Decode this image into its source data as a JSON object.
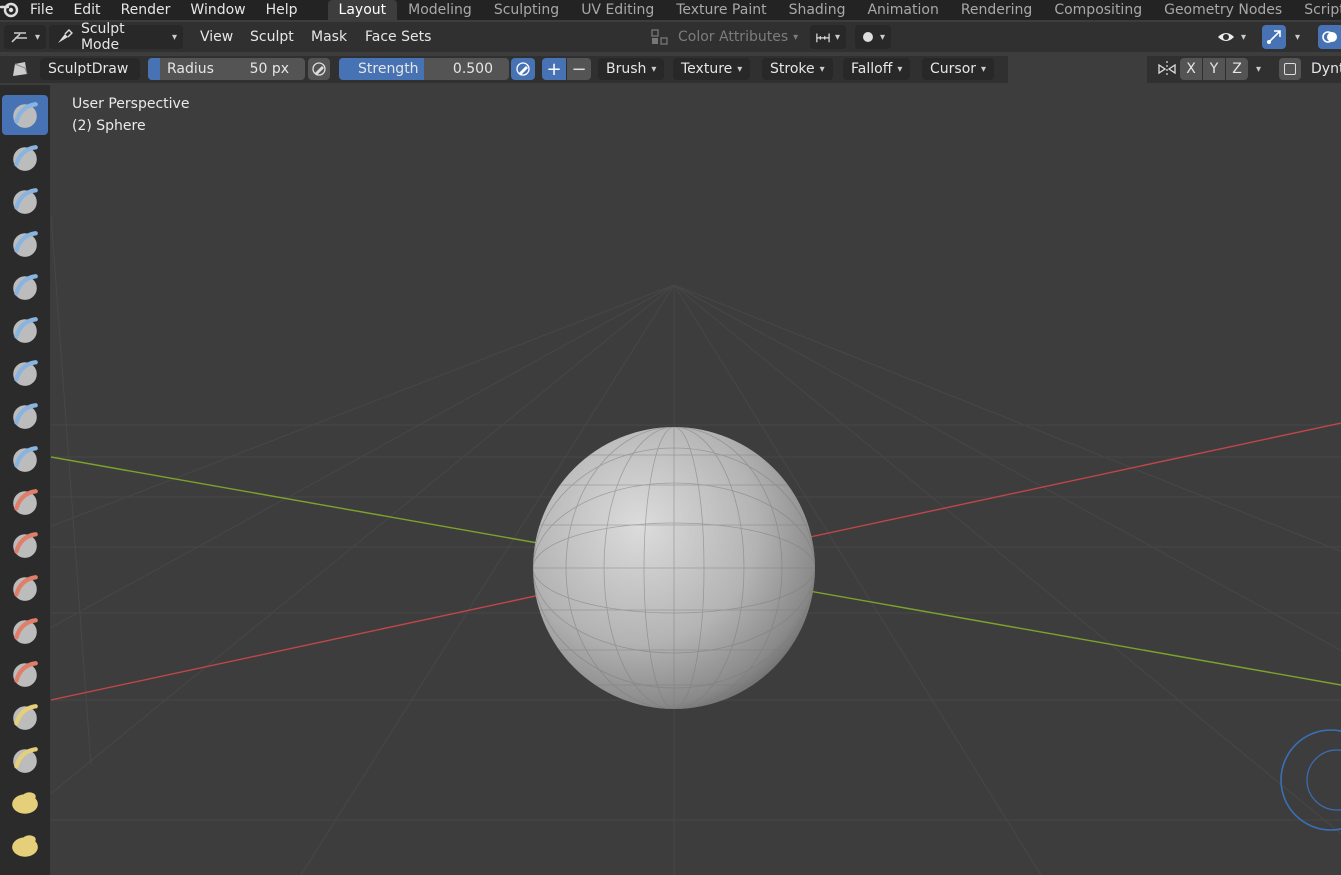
{
  "topbar": {
    "menus": [
      "File",
      "Edit",
      "Render",
      "Window",
      "Help"
    ],
    "workspaces": [
      "Layout",
      "Modeling",
      "Sculpting",
      "UV Editing",
      "Texture Paint",
      "Shading",
      "Animation",
      "Rendering",
      "Compositing",
      "Geometry Nodes",
      "Scripting"
    ],
    "active_workspace": "Layout"
  },
  "header": {
    "mode": "Sculpt Mode",
    "menus": [
      "View",
      "Sculpt",
      "Mask",
      "Face Sets"
    ],
    "color_attributes": "Color Attributes"
  },
  "tool_settings": {
    "brush_name": "SculptDraw",
    "radius_label": "Radius",
    "radius_value": "50 px",
    "strength_label": "Strength",
    "strength_value": "0.500",
    "strength_fraction": 0.5,
    "dropdowns": [
      "Brush",
      "Texture",
      "Stroke",
      "Falloff",
      "Cursor"
    ],
    "symmetry_axes": [
      "X",
      "Y",
      "Z"
    ],
    "dyntopo_label": "Dynt"
  },
  "viewport": {
    "view_name": "User Perspective",
    "object_name": "(2) Sphere"
  },
  "colors": {
    "accent": "#4772b3",
    "x_axis": "#c0464a",
    "y_axis": "#7ca32c",
    "viewport_bg": "#3d3d3d"
  },
  "brushes": [
    "draw-brush-icon",
    "draw-sharp-brush-icon",
    "clay-brush-icon",
    "clay-strips-brush-icon",
    "clay-thumb-brush-icon",
    "layer-brush-icon",
    "inflate-brush-icon",
    "blob-brush-icon",
    "crease-brush-icon",
    "smooth-brush-icon",
    "flatten-brush-icon",
    "fill-brush-icon",
    "scrape-brush-icon",
    "multiplane-scrape-brush-icon",
    "pinch-brush-icon",
    "grab-brush-icon",
    "elastic-deform-brush-icon",
    "snake-hook-brush-icon"
  ]
}
